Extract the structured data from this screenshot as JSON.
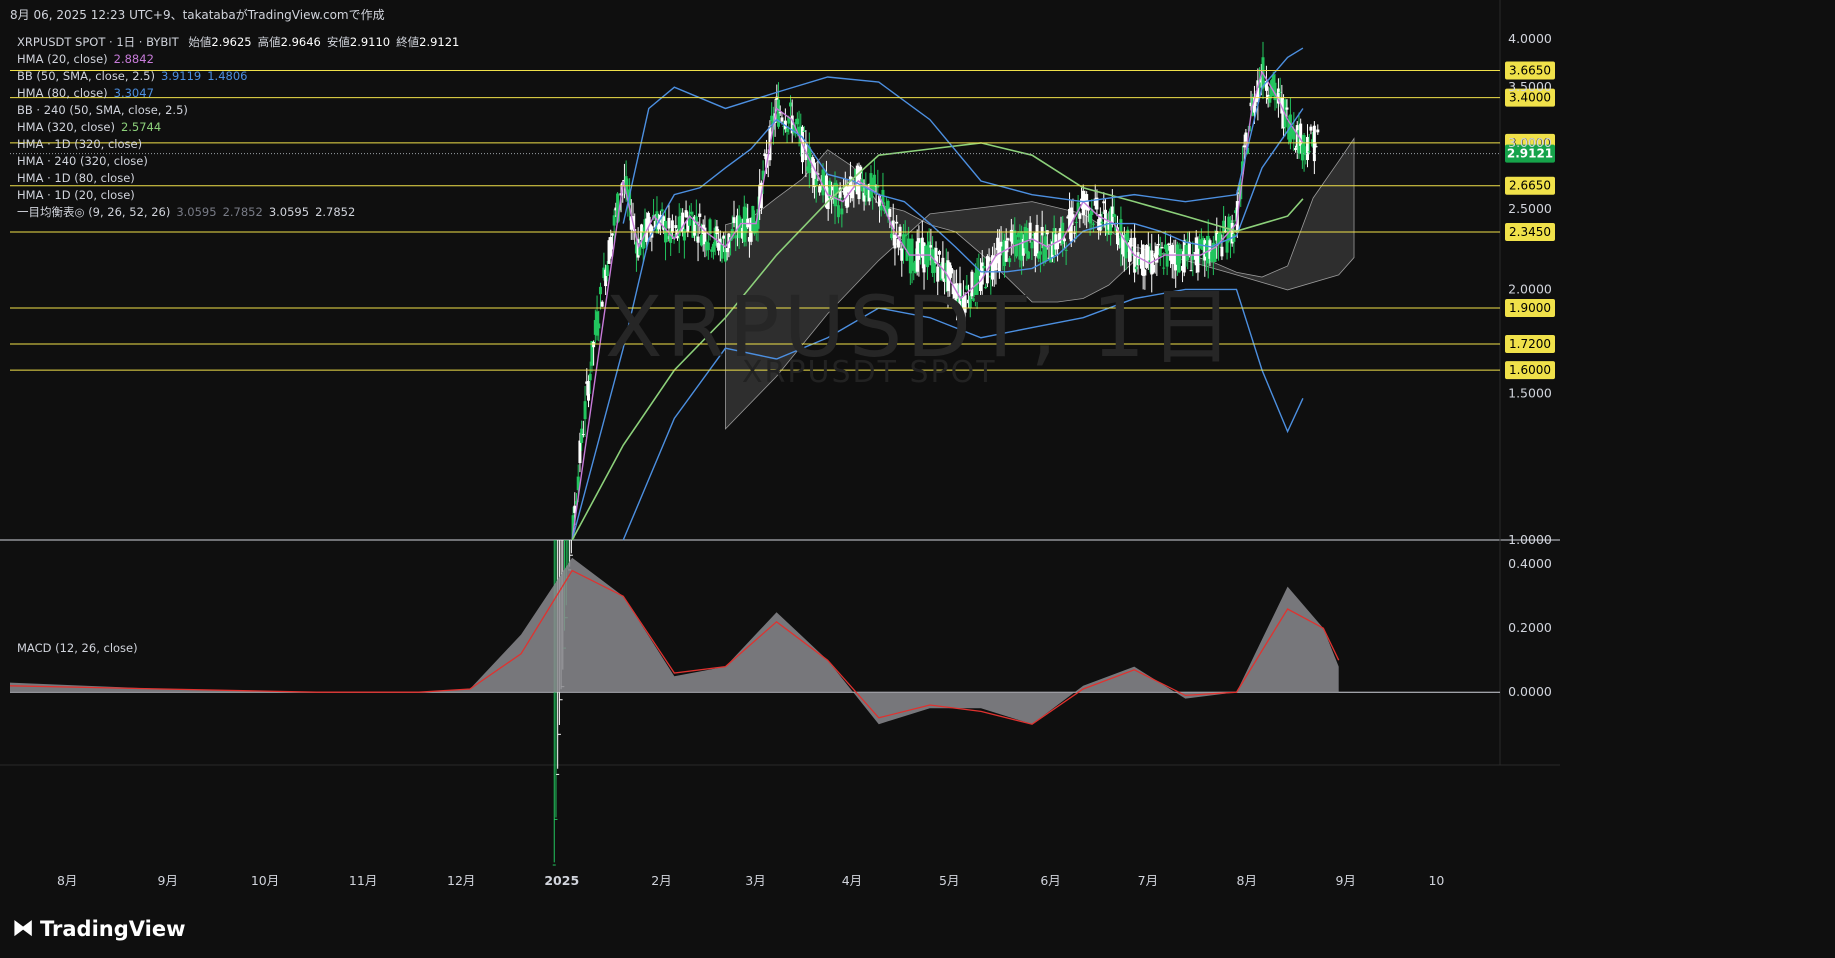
{
  "header": {
    "timestamp": "8月 06, 2025 12:23 UTC+9、takatabaがTradingView.comで作成"
  },
  "legend": {
    "symbol": "XRPUSDT SPOT · 1日 · BYBIT",
    "ohlc": [
      {
        "label": "始値",
        "value": "2.9625"
      },
      {
        "label": "高値",
        "value": "2.9646"
      },
      {
        "label": "安値",
        "value": "2.9110"
      },
      {
        "label": "終値",
        "value": "2.9121"
      }
    ],
    "indicators": [
      {
        "label": "HMA (20, close)",
        "values": [
          "2.8842"
        ],
        "colors": [
          "#c77bd9"
        ]
      },
      {
        "label": "BB (50, SMA, close, 2.5)",
        "values": [
          "3.9119",
          "1.4806"
        ],
        "colors": [
          "#4c8fe0",
          "#4c8fe0"
        ]
      },
      {
        "label": "HMA (80, close)",
        "values": [
          "3.3047"
        ],
        "colors": [
          "#4c8fe0"
        ]
      },
      {
        "label": "BB · 240 (50, SMA, close, 2.5)",
        "values": [],
        "colors": []
      },
      {
        "label": "HMA (320, close)",
        "values": [
          "2.5744"
        ],
        "colors": [
          "#8cd07a"
        ]
      },
      {
        "label": "HMA · 1D (320, close)",
        "values": [],
        "colors": []
      },
      {
        "label": "HMA · 240 (320, close)",
        "values": [],
        "colors": []
      },
      {
        "label": "HMA · 1D (80, close)",
        "values": [],
        "colors": []
      },
      {
        "label": "HMA · 1D (20, close)",
        "values": [],
        "colors": []
      },
      {
        "label": "一目均衡表◎ (9, 26, 52, 26)",
        "values": [
          "3.0595",
          "2.7852",
          "3.0595",
          "2.7852"
        ],
        "colors": [
          "#787b86",
          "#787b86",
          "#d1d4dc",
          "#d1d4dc"
        ]
      }
    ]
  },
  "watermark": {
    "main": "XRPUSDT, 1日",
    "sub": "XRPUSDT SPOT"
  },
  "macd_label": "MACD (12, 26, close)",
  "brand": {
    "name": "TradingView"
  },
  "colors": {
    "background": "#0f0f0f",
    "candle_up": "#22c55e",
    "candle_down": "#ffffff",
    "hline": "#f0e14a",
    "price_label_bg": "#f0e14a",
    "last_price_bg": "#16a34a",
    "hma20": "#c77bd9",
    "hma80": "#4c8fe0",
    "bb": "#4c8fe0",
    "hma320": "#8cd07a",
    "cloud": "#3a3a3a",
    "macd_hist": "#8a8a8e",
    "macd_signal": "#e0322f"
  },
  "chart_data": [
    {
      "type": "line",
      "title": "XRPUSDT SPOT · 1日 · BYBIT",
      "y_scale": "log",
      "ylim": [
        1.0,
        4.1
      ],
      "y_ticks": [
        "1.0000",
        "1.5000",
        "2.0000",
        "2.5000",
        "3.0000",
        "3.5000",
        "4.0000"
      ],
      "x_ticks": [
        "8月",
        "9月",
        "10月",
        "11月",
        "12月",
        "2025",
        "2月",
        "3月",
        "4月",
        "5月",
        "6月",
        "7月",
        "8月",
        "9月",
        "10"
      ],
      "last_price": "2.9121",
      "horizontal_levels": [
        {
          "value": 3.665,
          "label": "3.6650"
        },
        {
          "value": 3.4,
          "label": "3.4000"
        },
        {
          "value": 3.0,
          "label": "3.0000"
        },
        {
          "value": 2.665,
          "label": "2.6650"
        },
        {
          "value": 2.345,
          "label": "2.3450"
        },
        {
          "value": 1.9,
          "label": "1.9000"
        },
        {
          "value": 1.72,
          "label": "1.7200"
        },
        {
          "value": 1.6,
          "label": "1.6000"
        }
      ],
      "series": [
        {
          "name": "HMA (20, close)",
          "points": [
            [
              11,
              1.0
            ],
            [
              12,
              2.7
            ],
            [
              12.3,
              2.25
            ],
            [
              12.6,
              2.45
            ],
            [
              13,
              2.3
            ],
            [
              13.3,
              2.45
            ],
            [
              13.6,
              2.35
            ],
            [
              14,
              2.25
            ],
            [
              14.3,
              2.4
            ],
            [
              14.6,
              2.4
            ],
            [
              15,
              3.3
            ],
            [
              15.3,
              3.2
            ],
            [
              15.6,
              2.9
            ],
            [
              16,
              2.6
            ],
            [
              16.3,
              2.55
            ],
            [
              16.6,
              2.7
            ],
            [
              17,
              2.6
            ],
            [
              17.3,
              2.35
            ],
            [
              17.6,
              2.2
            ],
            [
              18,
              2.2
            ],
            [
              18.3,
              2.1
            ],
            [
              18.6,
              1.95
            ],
            [
              19,
              2.05
            ],
            [
              19.3,
              2.2
            ],
            [
              19.6,
              2.25
            ],
            [
              20,
              2.3
            ],
            [
              20.3,
              2.25
            ],
            [
              20.6,
              2.3
            ],
            [
              21,
              2.55
            ],
            [
              21.3,
              2.45
            ],
            [
              21.6,
              2.4
            ],
            [
              22,
              2.2
            ],
            [
              22.3,
              2.15
            ],
            [
              22.6,
              2.2
            ],
            [
              23,
              2.2
            ],
            [
              23.3,
              2.2
            ],
            [
              23.6,
              2.25
            ],
            [
              24,
              2.4
            ],
            [
              24.3,
              3.3
            ],
            [
              24.5,
              3.65
            ],
            [
              24.8,
              3.4
            ],
            [
              25,
              3.2
            ],
            [
              25.3,
              3.0
            ]
          ]
        },
        {
          "name": "HMA (80, close)",
          "points": [
            [
              11,
              1.0
            ],
            [
              12,
              1.7
            ],
            [
              12.5,
              2.3
            ],
            [
              13,
              2.6
            ],
            [
              13.5,
              2.65
            ],
            [
              14,
              2.8
            ],
            [
              14.5,
              2.95
            ],
            [
              15,
              3.2
            ],
            [
              15.5,
              3.05
            ],
            [
              16,
              2.75
            ],
            [
              16.5,
              2.7
            ],
            [
              17,
              2.6
            ],
            [
              17.5,
              2.55
            ],
            [
              18,
              2.4
            ],
            [
              18.5,
              2.25
            ],
            [
              19,
              2.1
            ],
            [
              19.5,
              2.1
            ],
            [
              20,
              2.12
            ],
            [
              20.5,
              2.2
            ],
            [
              21,
              2.35
            ],
            [
              21.5,
              2.4
            ],
            [
              22,
              2.4
            ],
            [
              22.5,
              2.35
            ],
            [
              23,
              2.28
            ],
            [
              23.5,
              2.25
            ],
            [
              24,
              2.32
            ],
            [
              24.5,
              2.8
            ],
            [
              25,
              3.1
            ],
            [
              25.3,
              3.3
            ]
          ]
        },
        {
          "name": "HMA (320, close)",
          "points": [
            [
              11,
              1.0
            ],
            [
              12,
              1.3
            ],
            [
              13,
              1.6
            ],
            [
              14,
              1.85
            ],
            [
              15,
              2.2
            ],
            [
              16,
              2.55
            ],
            [
              17,
              2.9
            ],
            [
              18,
              2.95
            ],
            [
              19,
              3.0
            ],
            [
              20,
              2.9
            ],
            [
              21,
              2.65
            ],
            [
              22,
              2.55
            ],
            [
              23,
              2.45
            ],
            [
              24,
              2.35
            ],
            [
              25,
              2.45
            ],
            [
              25.3,
              2.57
            ]
          ]
        },
        {
          "name": "BB upper",
          "points": [
            [
              12,
              2.4
            ],
            [
              12.5,
              3.3
            ],
            [
              13,
              3.5
            ],
            [
              14,
              3.3
            ],
            [
              15,
              3.45
            ],
            [
              16,
              3.6
            ],
            [
              17,
              3.55
            ],
            [
              18,
              3.2
            ],
            [
              19,
              2.7
            ],
            [
              20,
              2.6
            ],
            [
              21,
              2.55
            ],
            [
              22,
              2.6
            ],
            [
              23,
              2.55
            ],
            [
              24,
              2.6
            ],
            [
              24.5,
              3.5
            ],
            [
              25,
              3.8
            ],
            [
              25.3,
              3.9
            ]
          ]
        },
        {
          "name": "BB lower",
          "points": [
            [
              12,
              1.0
            ],
            [
              13,
              1.4
            ],
            [
              14,
              1.7
            ],
            [
              15,
              1.65
            ],
            [
              16,
              1.75
            ],
            [
              17,
              1.9
            ],
            [
              18,
              1.85
            ],
            [
              19,
              1.75
            ],
            [
              20,
              1.8
            ],
            [
              21,
              1.85
            ],
            [
              22,
              1.95
            ],
            [
              23,
              2.0
            ],
            [
              24,
              2.0
            ],
            [
              24.5,
              1.6
            ],
            [
              25,
              1.35
            ],
            [
              25.3,
              1.48
            ]
          ]
        }
      ]
    },
    {
      "type": "area",
      "title": "MACD (12, 26, close)",
      "ylim": [
        -0.14,
        0.46
      ],
      "y_ticks": [
        "0.0000",
        "0.2000",
        "0.4000"
      ],
      "series": [
        {
          "name": "histogram",
          "points": [
            [
              0,
              0.03
            ],
            [
              3,
              0.01
            ],
            [
              6,
              0.0
            ],
            [
              8,
              0.0
            ],
            [
              9,
              0.01
            ],
            [
              10,
              0.18
            ],
            [
              11,
              0.42
            ],
            [
              12,
              0.3
            ],
            [
              13,
              0.05
            ],
            [
              14,
              0.08
            ],
            [
              15,
              0.25
            ],
            [
              16,
              0.1
            ],
            [
              17,
              -0.1
            ],
            [
              18,
              -0.05
            ],
            [
              19,
              -0.05
            ],
            [
              20,
              -0.1
            ],
            [
              21,
              0.02
            ],
            [
              22,
              0.08
            ],
            [
              23,
              -0.02
            ],
            [
              24,
              0.0
            ],
            [
              25,
              0.33
            ],
            [
              25.7,
              0.2
            ],
            [
              26,
              0.08
            ]
          ]
        },
        {
          "name": "signal",
          "points": [
            [
              0,
              0.02
            ],
            [
              3,
              0.01
            ],
            [
              6,
              0.0
            ],
            [
              8,
              0.0
            ],
            [
              9,
              0.01
            ],
            [
              10,
              0.12
            ],
            [
              11,
              0.38
            ],
            [
              12,
              0.3
            ],
            [
              13,
              0.06
            ],
            [
              14,
              0.08
            ],
            [
              15,
              0.22
            ],
            [
              16,
              0.1
            ],
            [
              17,
              -0.08
            ],
            [
              18,
              -0.04
            ],
            [
              19,
              -0.06
            ],
            [
              20,
              -0.1
            ],
            [
              21,
              0.01
            ],
            [
              22,
              0.07
            ],
            [
              23,
              -0.01
            ],
            [
              24,
              0.0
            ],
            [
              25,
              0.26
            ],
            [
              25.7,
              0.2
            ],
            [
              26,
              0.1
            ]
          ]
        }
      ]
    }
  ]
}
